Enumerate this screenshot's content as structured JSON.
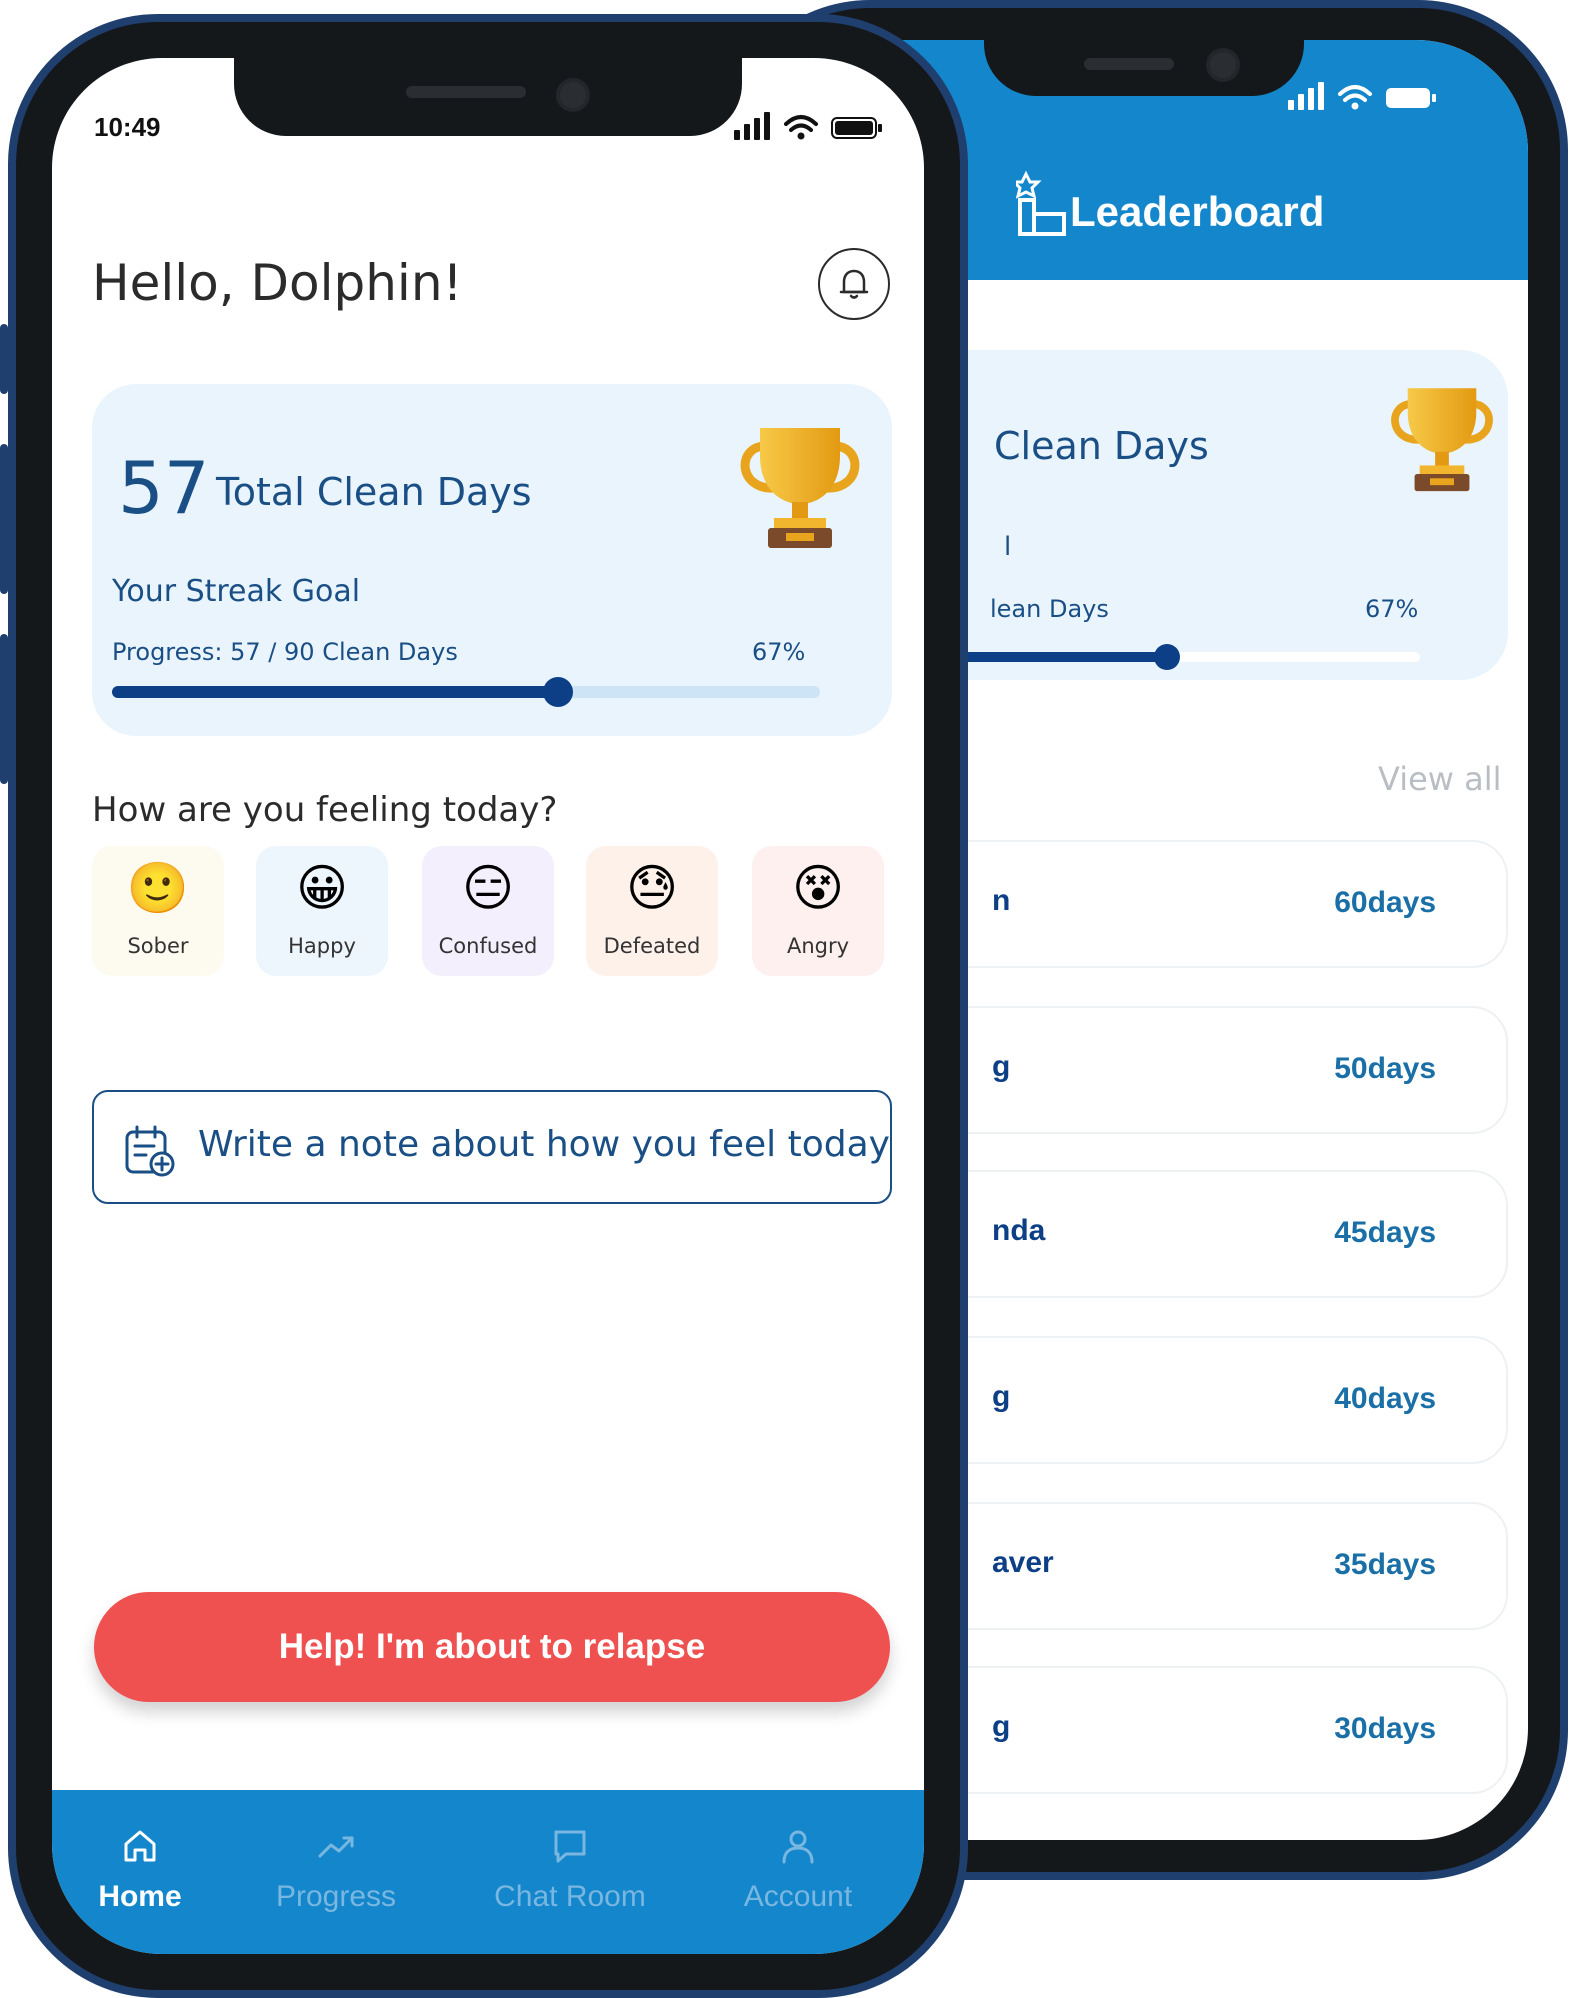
{
  "front": {
    "status": {
      "time": "10:49"
    },
    "greeting": "Hello, Dolphin!",
    "card": {
      "total_days": "57",
      "total_label": "Total Clean Days",
      "goal_label": "Your Streak Goal",
      "progress_text": "Progress: 57 / 90 Clean Days",
      "percent": "67%",
      "progress_fraction": 0.63
    },
    "feeling_title": "How are you feeling today?",
    "moods": [
      {
        "label": "Sober",
        "icon": "slight-smile-emoji",
        "emoji": "🙂",
        "bg": "#fdfbef"
      },
      {
        "label": "Happy",
        "icon": "grin-emoji",
        "emoji": "😀",
        "bg": "#eef6fd"
      },
      {
        "label": "Confused",
        "icon": "expressionless-emoji",
        "emoji": "😑",
        "bg": "#f4effc"
      },
      {
        "label": "Defeated",
        "icon": "downcast-sweat-emoji",
        "emoji": "😓",
        "bg": "#fdf1ea"
      },
      {
        "label": "Angry",
        "icon": "dizzy-eyes-emoji",
        "emoji": "😵",
        "bg": "#fdf0ef"
      }
    ],
    "note_prompt": "Write a note about how you feel today",
    "relapse_button": "Help! I'm about to relapse",
    "nav": [
      {
        "label": "Home",
        "icon": "home-icon"
      },
      {
        "label": "Progress",
        "icon": "trend-up-icon"
      },
      {
        "label": "Chat Room",
        "icon": "chat-bubble-icon"
      },
      {
        "label": "Account",
        "icon": "user-icon"
      }
    ],
    "colors": {
      "accent": "#1487cc",
      "primary_text": "#1a4f86",
      "danger": "#ef5050"
    }
  },
  "back": {
    "title": "Leaderboard",
    "card": {
      "headline": "Clean Days",
      "goal_fragment": "l",
      "progress_fragment": "lean Days",
      "percent": "67%",
      "progress_fraction": 0.45
    },
    "view_all": "View all",
    "rows": [
      {
        "name": "n",
        "days": "60days"
      },
      {
        "name": "g",
        "days": "50days"
      },
      {
        "name": "nda",
        "days": "45days"
      },
      {
        "name": "g",
        "days": "40days"
      },
      {
        "name": "aver",
        "days": "35days"
      },
      {
        "name": "g",
        "days": "30days"
      }
    ]
  }
}
